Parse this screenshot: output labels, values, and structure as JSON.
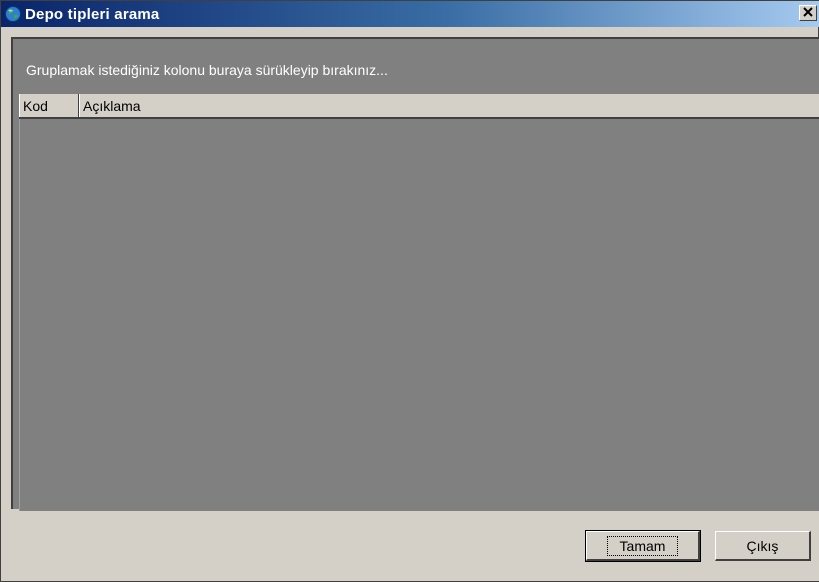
{
  "window": {
    "title": "Depo tipleri arama",
    "close_symbol": "✕",
    "icon": "globe-icon"
  },
  "group_area": {
    "hint": "Gruplamak istediğiniz kolonu buraya sürükleyip bırakınız..."
  },
  "grid": {
    "columns": [
      {
        "label": "Kod"
      },
      {
        "label": "Açıklama"
      }
    ],
    "rows": []
  },
  "buttons": {
    "ok_label": "Tamam",
    "exit_label": "Çıkış"
  },
  "colors": {
    "titlebar_start": "#0a246a",
    "titlebar_end": "#a6caf0",
    "client_background": "#808080",
    "face": "#d4d0c8"
  }
}
